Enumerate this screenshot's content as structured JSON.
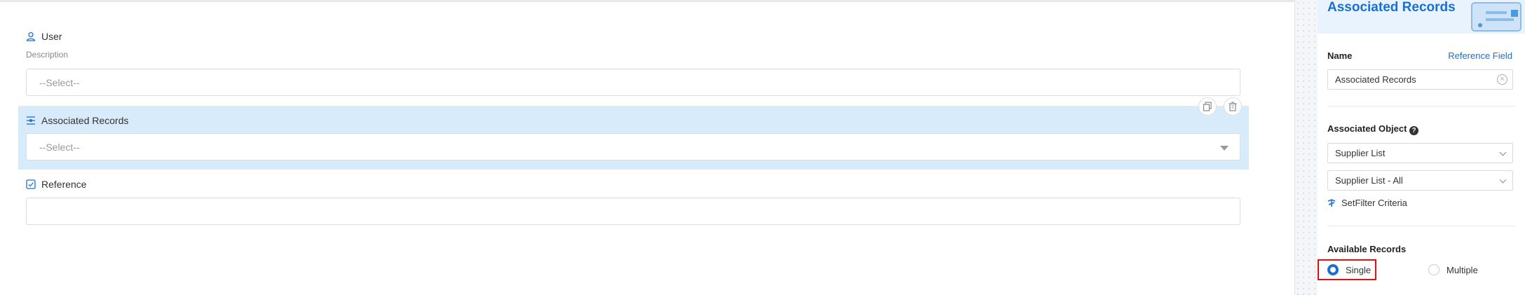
{
  "form": {
    "user": {
      "label": "User",
      "description": "Description",
      "placeholder": "--Select--"
    },
    "associated_records": {
      "label": "Associated Records",
      "placeholder": "--Select--"
    },
    "reference": {
      "label": "Reference",
      "value": ""
    }
  },
  "panel": {
    "title": "Associated Records",
    "name_label": "Name",
    "reference_field_link": "Reference Field",
    "name_value": "Associated Records",
    "associated_object_label": "Associated Object",
    "object_select": "Supplier List",
    "view_select": "Supplier List - All",
    "filter_link": "SetFilter Criteria",
    "available_records_label": "Available Records",
    "options": [
      {
        "label": "Single",
        "selected": true
      },
      {
        "label": "Multiple",
        "selected": false
      }
    ]
  },
  "colors": {
    "accent": "#1b6fd1",
    "selection_bg": "#d8ebfb",
    "highlight": "#e01010"
  }
}
